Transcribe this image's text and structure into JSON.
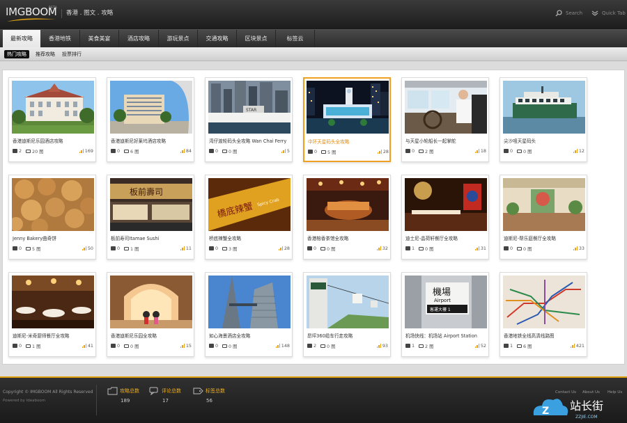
{
  "header": {
    "logo_img": "IMG",
    "logo_boom": "BOOM",
    "logo_beta": "BETA",
    "tagline": "香港 . 图文 . 攻略",
    "search_label": "Search",
    "quicktab_label": "Quick Tab"
  },
  "nav": {
    "tabs": [
      "最新攻略",
      "香港地铁",
      "美食美宴",
      "酒店攻略",
      "游玩景点",
      "交通攻略",
      "区块景点",
      "标签云"
    ]
  },
  "subnav": {
    "items": [
      "热门攻略",
      "推荐攻略",
      "投票排行"
    ]
  },
  "cards": [
    {
      "title": "香港迪斯尼乐园酒店攻略",
      "comments": "2",
      "images": "20 图",
      "views": "169"
    },
    {
      "title": "香港迪斯尼好莱坞酒店攻略",
      "comments": "0",
      "images": "6 图",
      "views": "84"
    },
    {
      "title": "湾仔渡轮码头全攻略 Wan Chai Ferry",
      "comments": "0",
      "images": "0 图",
      "views": "5"
    },
    {
      "title": "中环天星码头全攻略",
      "comments": "0",
      "images": "5 图",
      "views": "28"
    },
    {
      "title": "与天星小轮船长一起掌舵",
      "comments": "0",
      "images": "2 图",
      "views": "18"
    },
    {
      "title": "尖沙咀天星码头",
      "comments": "0",
      "images": "0 图",
      "views": "12"
    },
    {
      "title": "Jenny Bakery曲奇饼",
      "comments": "0",
      "images": "5 图",
      "views": "50"
    },
    {
      "title": "板前寿司Itamae Sushi",
      "comments": "0",
      "images": "1 图",
      "views": "11"
    },
    {
      "title": "桥底辣蟹全攻略",
      "comments": "0",
      "images": "3 图",
      "views": "28"
    },
    {
      "title": "香港榕香茶馆全攻略",
      "comments": "0",
      "images": "0 图",
      "views": "32"
    },
    {
      "title": "迪士尼-晶荷轩餐厅全攻略",
      "comments": "1",
      "images": "0 图",
      "views": "31"
    },
    {
      "title": "迪斯尼-帮乐庭餐厅全攻略",
      "comments": "0",
      "images": "0 图",
      "views": "33"
    },
    {
      "title": "迪斯尼-米奇厨师餐厅全攻略",
      "comments": "0",
      "images": "1 图",
      "views": "41"
    },
    {
      "title": "香港迪斯尼乐园全攻略",
      "comments": "0",
      "images": "0 图",
      "views": "15"
    },
    {
      "title": "如心海景酒店全攻略",
      "comments": "0",
      "images": "0 图",
      "views": "148"
    },
    {
      "title": "昂坪360缆车行走攻略",
      "comments": "2",
      "images": "0 图",
      "views": "93"
    },
    {
      "title": "机场快线：机场站 Airport Station",
      "comments": "1",
      "images": "2 图",
      "views": "52"
    },
    {
      "title": "香港地铁全线高清线路图",
      "comments": "1",
      "images": "6 图",
      "views": "421"
    }
  ],
  "photo_signs": {
    "sushi_sign": "板前壽司",
    "crab_sign": "橋底辣蟹",
    "crab_sub": "Spicy Crab",
    "airport_cn": "機場",
    "airport_en": "Airport",
    "airport_terminal": "客運大樓 1",
    "ferry_sign": "STAR"
  },
  "footer": {
    "copyright": "Copyright © IMGBOOM All Rights Reserved",
    "powered": "Powered by Ideaboom",
    "stats": [
      {
        "label": "攻略总数",
        "value": "189"
      },
      {
        "label": "评论总数",
        "value": "17"
      },
      {
        "label": "标签总数",
        "value": "56"
      }
    ],
    "links": [
      "Contact Us",
      "About Us",
      "Help Us"
    ],
    "badge_name": "站长街",
    "badge_url": "ZZJIE.COM"
  },
  "colors": {
    "accent_orange": "#f0a020",
    "header_dark": "#1c1c1c",
    "badge_blue": "#3aa0e0"
  }
}
